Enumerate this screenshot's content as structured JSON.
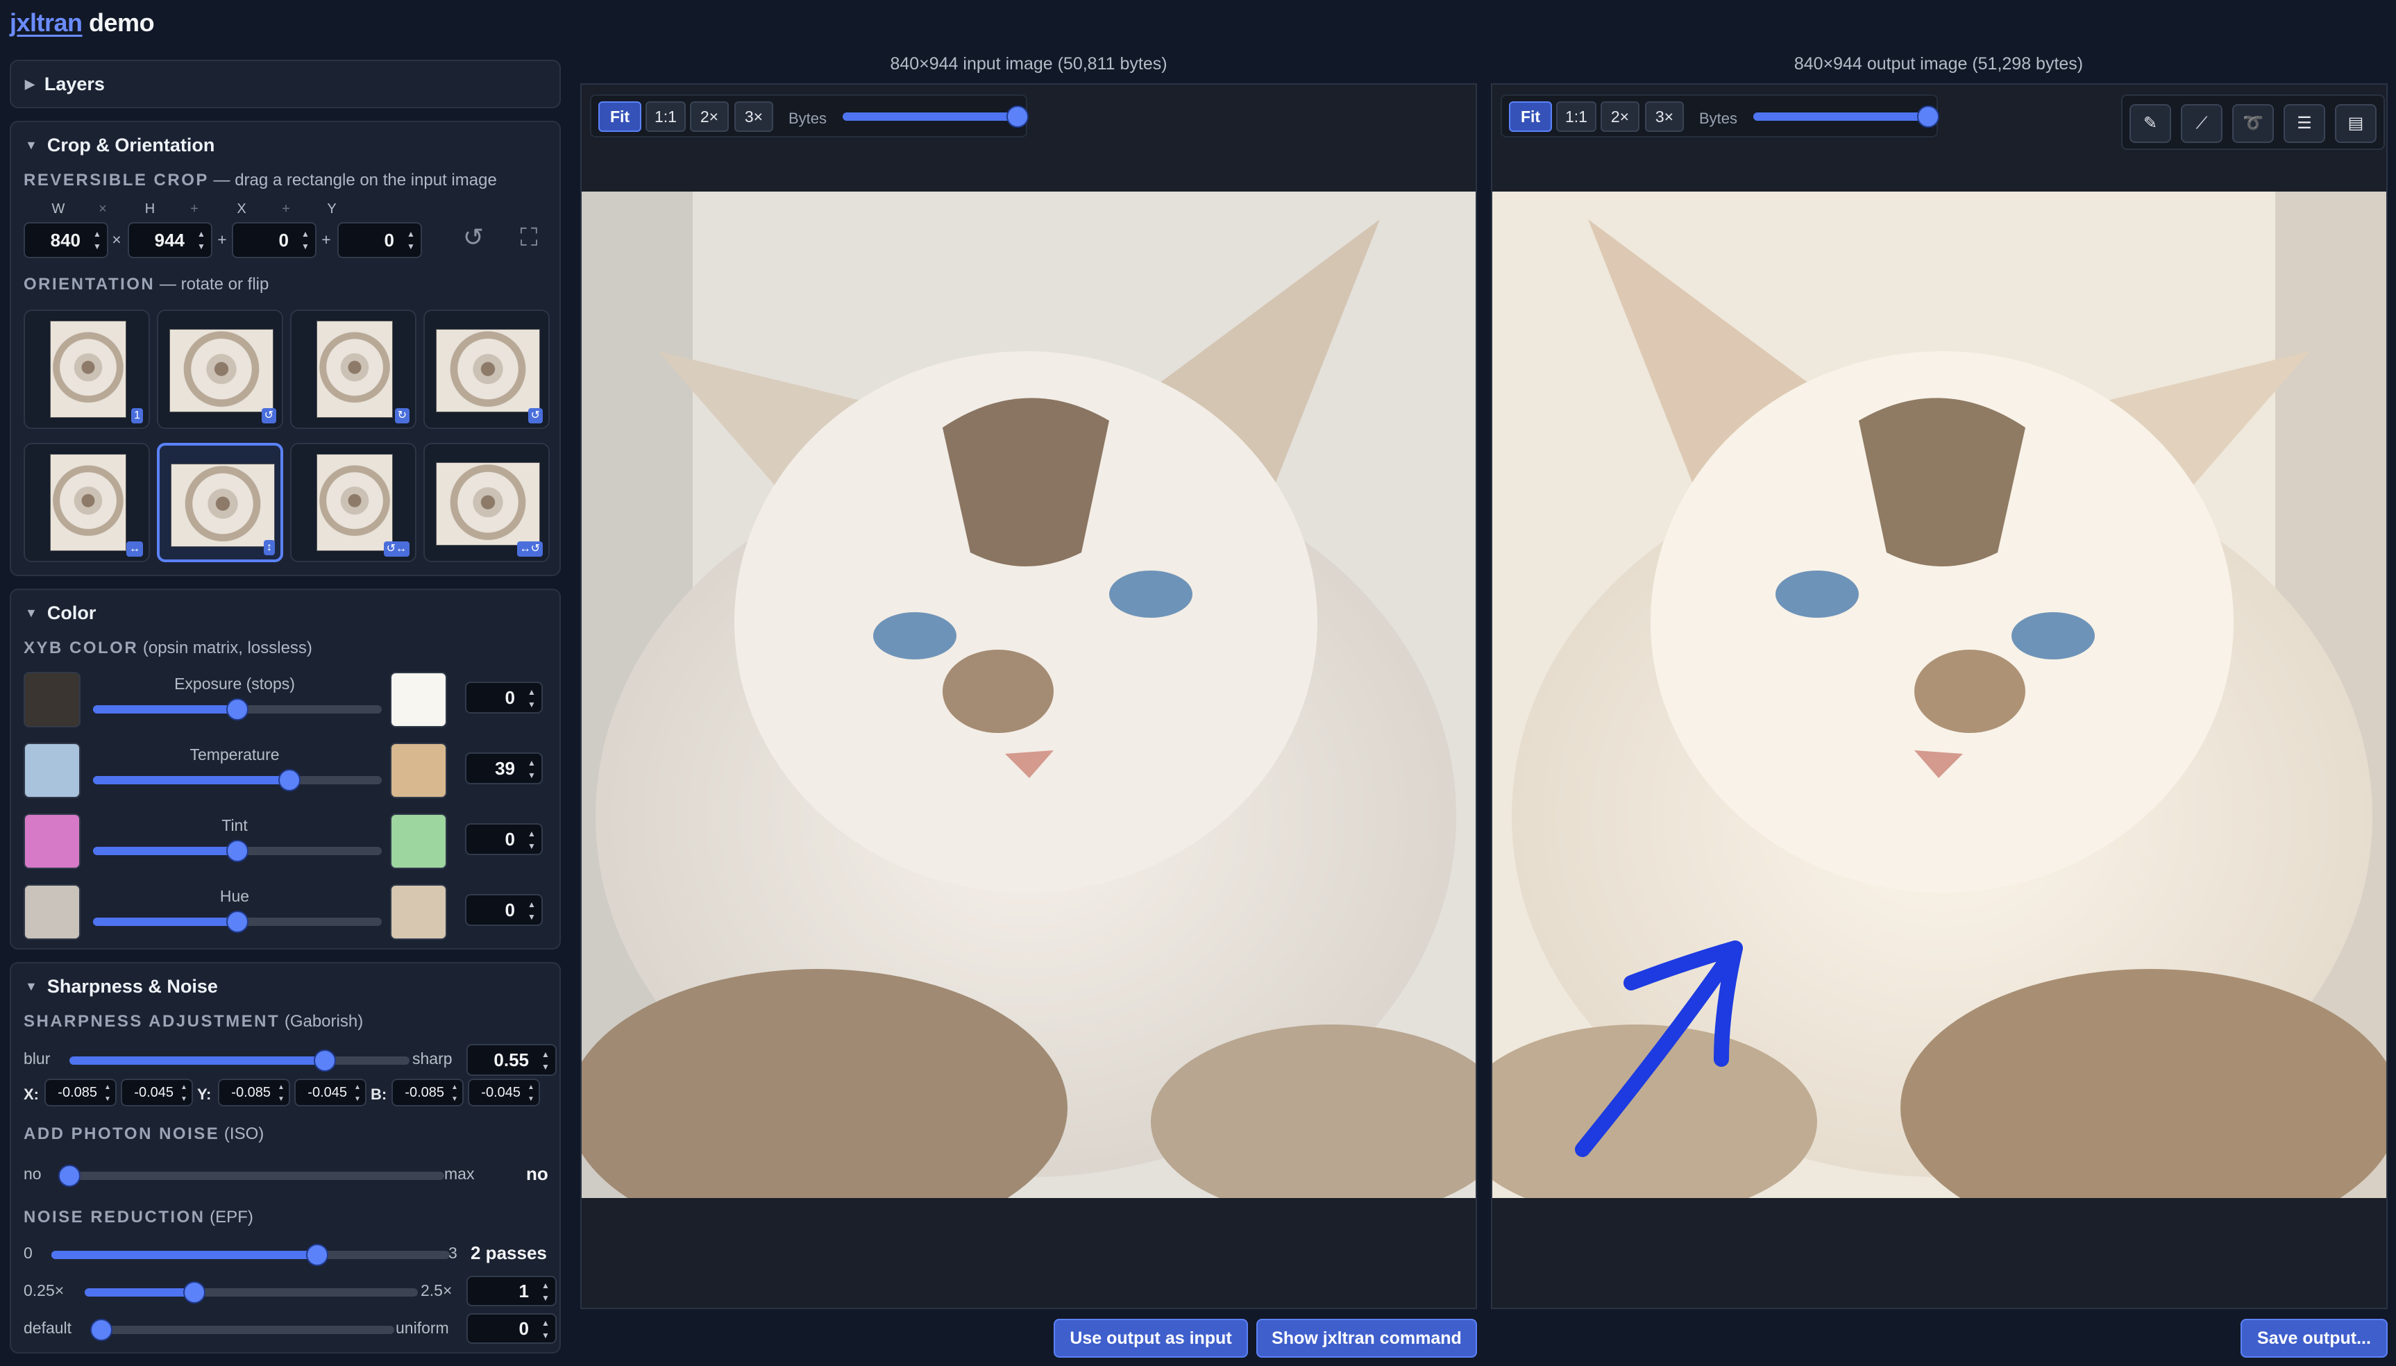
{
  "brand": {
    "link": "jxltran",
    "rest": " demo"
  },
  "layers_panel": {
    "title": "Layers"
  },
  "crop_panel": {
    "title": "Crop & Orientation",
    "crop_heading": "REVERSIBLE CROP",
    "crop_hint": " — drag a rectangle on the input image",
    "w_label": "W",
    "h_label": "H",
    "x_label": "X",
    "y_label": "Y",
    "times": "×",
    "plus": "+",
    "w": "840",
    "h": "944",
    "x": "0",
    "y": "0",
    "orientation_heading": "ORIENTATION",
    "orientation_hint": " — rotate or flip",
    "thumbs": [
      {
        "badge": "1"
      },
      {
        "badge": "↺"
      },
      {
        "badge": "↻"
      },
      {
        "badge": "↺"
      },
      {
        "badge": "↔"
      },
      {
        "badge": "↕"
      },
      {
        "badge": "↺↔"
      },
      {
        "badge": "↔↺"
      }
    ],
    "selected_orientation": 5
  },
  "color_panel": {
    "title": "Color",
    "heading": "XYB COLOR",
    "hint": " (opsin matrix, lossless)",
    "sliders": [
      {
        "label": "Exposure (stops)",
        "value": "0",
        "level": 0.5
      },
      {
        "label": "Temperature",
        "value": "39",
        "level": 0.68
      },
      {
        "label": "Tint",
        "value": "0",
        "level": 0.5
      },
      {
        "label": "Hue",
        "value": "0",
        "level": 0.5
      }
    ]
  },
  "sharp_panel": {
    "title": "Sharpness & Noise",
    "sharp_heading": "SHARPNESS ADJUSTMENT",
    "sharp_hint": " (Gaborish)",
    "blur": "blur",
    "sharp": "sharp",
    "sharp_value": "0.55",
    "sharp_level": 0.75,
    "channels": [
      {
        "label": "X:",
        "a": "-0.085",
        "b": "-0.045"
      },
      {
        "label": "Y:",
        "a": "-0.085",
        "b": "-0.045"
      },
      {
        "label": "B:",
        "a": "-0.085",
        "b": "-0.045"
      }
    ],
    "noise_heading": "ADD PHOTON NOISE",
    "noise_hint": " (ISO)",
    "noise_min": "no",
    "noise_max": "max",
    "noise_value": "no",
    "noise_level": 0,
    "epf_heading": "NOISE REDUCTION",
    "epf_hint": " (EPF)",
    "epf_min": "0",
    "epf_max": "3",
    "epf_value": "2 passes",
    "epf_level": 0.667,
    "mult_min": "0.25×",
    "mult_max": "2.5×",
    "mult_value": "1",
    "mult_level": 0.33,
    "mode_min": "default",
    "mode_max": "uniform",
    "mode_value": "0",
    "mode_level": 0
  },
  "input_view": {
    "caption": "840×944 input image (50,811 bytes)",
    "zoom": [
      "Fit",
      "1:1",
      "2×",
      "3×"
    ],
    "bytes_label": "Bytes",
    "bytes_level": 1.0
  },
  "output_view": {
    "caption": "840×944 output image (51,298 bytes)",
    "zoom": [
      "Fit",
      "1:1",
      "2×",
      "3×"
    ],
    "bytes_label": "Bytes",
    "bytes_level": 1.0,
    "tools": [
      {
        "icon": "pencil-icon",
        "glyph": "✎"
      },
      {
        "icon": "line-tool-icon",
        "glyph": "⟋"
      },
      {
        "icon": "lasso-icon",
        "glyph": "➰"
      },
      {
        "icon": "menu-icon",
        "glyph": "☰"
      },
      {
        "icon": "document-icon",
        "glyph": "▤"
      }
    ]
  },
  "buttons": {
    "use_output": "Use output as input",
    "show_cmd": "Show jxltran command",
    "save": "Save output..."
  },
  "colors": {
    "accent": "#5b82f8",
    "bg": "#111827",
    "panel": "#1b2232",
    "pen_stroke": "#1d3be0"
  }
}
